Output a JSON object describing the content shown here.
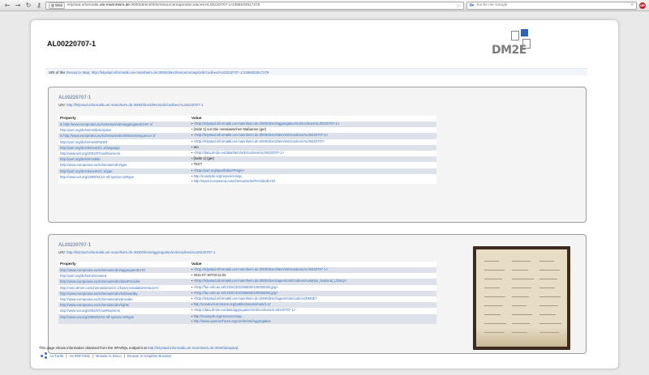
{
  "browser": {
    "site_label": "Web",
    "url_prefix": "lelystad.informatik.",
    "url_domain": "uni-mannheim.de",
    "url_rest": ":3000/direct/html/resourcemap/onb/codices/AL00220707-1/1386933617279",
    "search_placeholder": "Suche mit Google",
    "search_engine_icon": "google-icon"
  },
  "page": {
    "title": "AL00220707-1",
    "logo_text": "DM2E",
    "resource_map_label": "URI of this",
    "resource_map_link": "Resource Map",
    "resource_map_uri": "http://lelystad.informatik.uni-mannheim.de:3000/direct/resourcemap/onb/codices/AL00220707-1/1386933617279"
  },
  "box1": {
    "title": "AL00220707-1",
    "uri_label": "URI:",
    "uri": "http://lelystad.informatik.uni-mannheim.de:3000/direct/item/onb/codices/AL00220707-1",
    "headers": [
      "Property",
      "Value"
    ],
    "rows": [
      {
        "prop": "is http://www.europeana.eu/schemas/edm/aggregatedCHO of",
        "values": [
          "<http://lelystad.informatik.uni-mannheim.de:3000/direct/aggregation/onb/codices/AL00220707-1>"
        ]
      },
      {
        "prop": "http://purl.org/dc/terms/description",
        "values": [
          "[Seite 1] von Die messianischen Maßamen (ger)"
        ]
      },
      {
        "prop": "is http://www.europeana.eu/schemas/edm/isNextInSequence of",
        "values": [
          "<http://lelystad.informatik.uni-mannheim.de:3000/direct/item/onb/codices/AL00220707-2>"
        ]
      },
      {
        "prop": "http://purl.org/dc/terms/isPartOf",
        "values": [
          "<http://lelystad.informatik.uni-mannheim.de:3000/direct/item/onb/codices/AL00220707>"
        ]
      },
      {
        "prop": "http://purl.org/dc/elements/1.1/language",
        "values": [
          "aro"
        ]
      },
      {
        "prop": "http://www.w3.org/2002/07/owl#sameAs",
        "values": [
          "<http://data.dm2e.eu/data/item/onb/codices/AL00220707-1>"
        ]
      },
      {
        "prop": "http://purl.org/dc/terms/title",
        "values": [
          "[Seite 1] (ger)"
        ]
      },
      {
        "prop": "http://www.europeana.eu/schemas/edm/type",
        "values": [
          "TEXT"
        ]
      },
      {
        "prop": "http://purl.org/dc/elements/1.1/type",
        "values": [
          "<http://purl.org/spar/fabio/#Page>"
        ]
      },
      {
        "prop": "http://www.w3.org/1999/02/22-rdf-syntax-ns#type",
        "values": [
          "http://example.org/resourcemap",
          "http://www.europeana.eu/schemas/edm/ProvidedCHO"
        ]
      }
    ]
  },
  "box2": {
    "title": "AL00220707-1",
    "uri_label": "URI:",
    "uri": "http://lelystad.informatik.uni-mannheim.de:3000/direct/aggregation/onb/codices/AL00220707-1",
    "headers": [
      "Property",
      "Value"
    ],
    "rows": [
      {
        "prop": "http://www.europeana.eu/schemas/edm/aggregatedCHO",
        "values": [
          "<http://lelystad.informatik.uni-mannheim.de:3000/direct/item/onb/codices/AL00220707-1>"
        ]
      },
      {
        "prop": "http://purl.org/dc/terms/created",
        "values": [
          "2011-07-16T03:11:03"
        ]
      },
      {
        "prop": "http://www.europeana.eu/schemas/edm/dataProvider",
        "values": [
          "<http://lelystad.informatik.uni-mannheim.de:3000/direct/agent/onb/codices/Austrian_National_Library>"
        ]
      },
      {
        "prop": "http://onto.dm2e.eu/schemas/dm2e/1.1/hasAnnotatableVersionAt",
        "values": [
          "<http://fue.onb.ac.at/CODICES/296850/100000000.jpg>"
        ]
      },
      {
        "prop": "http://www.europeana.eu/schemas/edm/isShownBy",
        "values": [
          "<http://fue.onb.ac.at/CODICES/296850/100000000.jpg>"
        ]
      },
      {
        "prop": "http://www.europeana.eu/schemas/edm/provider",
        "values": [
          "<http://lelystad.informatik.uni-mannheim.de:3000/direct/agent/onb/codices/DM2E>"
        ]
      },
      {
        "prop": "http://www.europeana.eu/schemas/edm/rights",
        "values": [
          "http://creativecommons.org/publicdomain/mark/1.0/"
        ]
      },
      {
        "prop": "http://www.w3.org/2002/07/owl#sameAs",
        "values": [
          "<http://data.dm2e.eu/data/aggregation/onb/codices/AL00220707-1>"
        ]
      },
      {
        "prop": "http://www.w3.org/1999/02/22-rdf-syntax-ns#type",
        "values": [
          "http://example.org/resourcemap",
          "http://www.openarchives.org/ore/terms/Aggregation"
        ]
      }
    ]
  },
  "footer": {
    "text": "This page shows information obtained from the SPARQL endpoint at",
    "endpoint": "http://lelystad.informatik.uni-mannheim.de:3040/ds/sparql",
    "links": [
      "As Turtle",
      "As RDF/XML",
      "Browse in Disco",
      "Browse in Graphite Browser"
    ]
  }
}
